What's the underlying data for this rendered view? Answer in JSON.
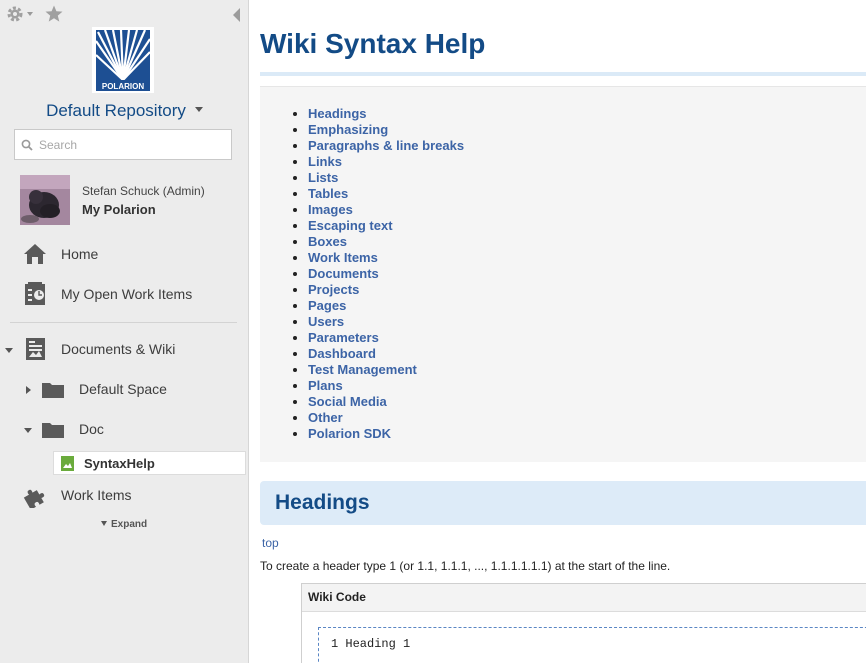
{
  "sidebar": {
    "repository": "Default Repository",
    "logo_text": "POLARION",
    "search_placeholder": "Search",
    "user": {
      "name": "Stefan Schuck (Admin)",
      "link": "My Polarion"
    },
    "nav": {
      "home": "Home",
      "open_work_items": "My Open Work Items",
      "documents_wiki": "Documents & Wiki",
      "default_space": "Default Space",
      "doc": "Doc",
      "syntax_help": "SyntaxHelp",
      "work_items": "Work Items",
      "expand": "Expand"
    }
  },
  "main": {
    "title": "Wiki Syntax Help",
    "toc": [
      "Headings",
      "Emphasizing",
      "Paragraphs & line breaks",
      "Links",
      "Lists",
      "Tables",
      "Images",
      "Escaping text",
      "Boxes",
      "Work Items",
      "Documents",
      "Projects",
      "Pages",
      "Users",
      "Parameters",
      "Dashboard",
      "Test Management",
      "Plans",
      "Social Media",
      "Other",
      "Polarion SDK"
    ],
    "section_heading": "Headings",
    "top_link": "top",
    "description": "To create a header type 1 (or 1.1, 1.1.1, ..., 1.1.1.1.1.1) at the start of the line.",
    "code_header": "Wiki Code",
    "code_sample": "1 Heading 1"
  },
  "colors": {
    "accent": "#134b86",
    "link": "#3c64a6",
    "sidebar_bg": "#ececec",
    "section_bg": "#ddebf8"
  }
}
